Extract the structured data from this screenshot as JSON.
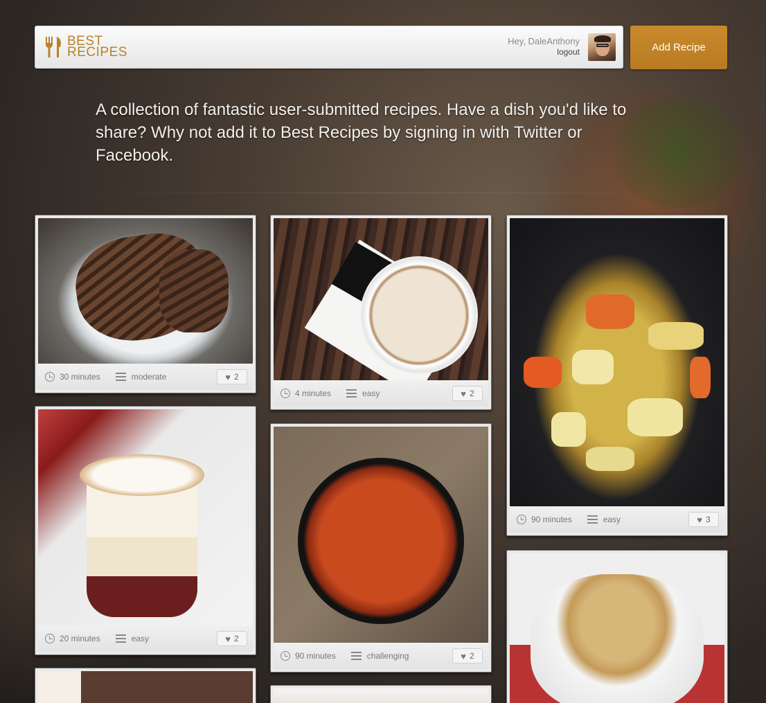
{
  "header": {
    "logo_line1": "BEST",
    "logo_line2": "RECIPES",
    "greeting": "Hey, DaleAnthony",
    "logout_label": "logout"
  },
  "add_recipe_label": "Add Recipe",
  "intro_text": "A collection of fantastic user-submitted recipes. Have a dish you'd like to share? Why not add it to Best Recipes by signing in with Twitter or Facebook.",
  "colors": {
    "accent": "#c0842a",
    "header_bg": "#f0f0f0"
  },
  "recipes": [
    {
      "time": "30 minutes",
      "difficulty": "moderate",
      "likes": "2"
    },
    {
      "time": "20 minutes",
      "difficulty": "easy",
      "likes": "2"
    },
    {
      "time": "4 minutes",
      "difficulty": "easy",
      "likes": "2"
    },
    {
      "time": "90 minutes",
      "difficulty": "challenging",
      "likes": "2"
    },
    {
      "time": "90 minutes",
      "difficulty": "easy",
      "likes": "3"
    }
  ],
  "icons": {
    "logo": "fork-knife-icon",
    "time": "clock-icon",
    "difficulty": "bars-icon",
    "likes": "heart-icon"
  }
}
